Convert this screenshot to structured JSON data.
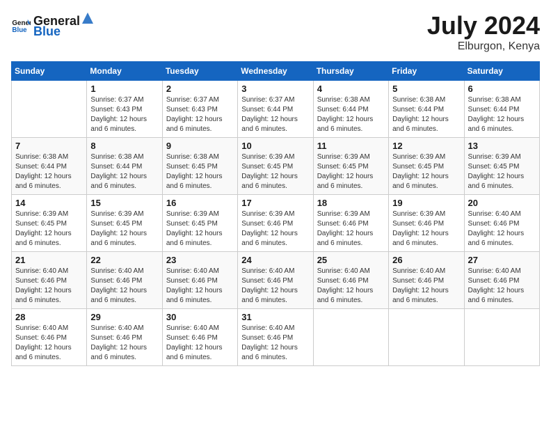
{
  "header": {
    "logo_general": "General",
    "logo_blue": "Blue",
    "month": "July 2024",
    "location": "Elburgon, Kenya"
  },
  "weekdays": [
    "Sunday",
    "Monday",
    "Tuesday",
    "Wednesday",
    "Thursday",
    "Friday",
    "Saturday"
  ],
  "weeks": [
    [
      {
        "day": "",
        "sunrise": "",
        "sunset": "",
        "daylight": ""
      },
      {
        "day": "1",
        "sunrise": "Sunrise: 6:37 AM",
        "sunset": "Sunset: 6:43 PM",
        "daylight": "Daylight: 12 hours and 6 minutes."
      },
      {
        "day": "2",
        "sunrise": "Sunrise: 6:37 AM",
        "sunset": "Sunset: 6:43 PM",
        "daylight": "Daylight: 12 hours and 6 minutes."
      },
      {
        "day": "3",
        "sunrise": "Sunrise: 6:37 AM",
        "sunset": "Sunset: 6:44 PM",
        "daylight": "Daylight: 12 hours and 6 minutes."
      },
      {
        "day": "4",
        "sunrise": "Sunrise: 6:38 AM",
        "sunset": "Sunset: 6:44 PM",
        "daylight": "Daylight: 12 hours and 6 minutes."
      },
      {
        "day": "5",
        "sunrise": "Sunrise: 6:38 AM",
        "sunset": "Sunset: 6:44 PM",
        "daylight": "Daylight: 12 hours and 6 minutes."
      },
      {
        "day": "6",
        "sunrise": "Sunrise: 6:38 AM",
        "sunset": "Sunset: 6:44 PM",
        "daylight": "Daylight: 12 hours and 6 minutes."
      }
    ],
    [
      {
        "day": "7",
        "sunrise": "Sunrise: 6:38 AM",
        "sunset": "Sunset: 6:44 PM",
        "daylight": "Daylight: 12 hours and 6 minutes."
      },
      {
        "day": "8",
        "sunrise": "Sunrise: 6:38 AM",
        "sunset": "Sunset: 6:44 PM",
        "daylight": "Daylight: 12 hours and 6 minutes."
      },
      {
        "day": "9",
        "sunrise": "Sunrise: 6:38 AM",
        "sunset": "Sunset: 6:45 PM",
        "daylight": "Daylight: 12 hours and 6 minutes."
      },
      {
        "day": "10",
        "sunrise": "Sunrise: 6:39 AM",
        "sunset": "Sunset: 6:45 PM",
        "daylight": "Daylight: 12 hours and 6 minutes."
      },
      {
        "day": "11",
        "sunrise": "Sunrise: 6:39 AM",
        "sunset": "Sunset: 6:45 PM",
        "daylight": "Daylight: 12 hours and 6 minutes."
      },
      {
        "day": "12",
        "sunrise": "Sunrise: 6:39 AM",
        "sunset": "Sunset: 6:45 PM",
        "daylight": "Daylight: 12 hours and 6 minutes."
      },
      {
        "day": "13",
        "sunrise": "Sunrise: 6:39 AM",
        "sunset": "Sunset: 6:45 PM",
        "daylight": "Daylight: 12 hours and 6 minutes."
      }
    ],
    [
      {
        "day": "14",
        "sunrise": "Sunrise: 6:39 AM",
        "sunset": "Sunset: 6:45 PM",
        "daylight": "Daylight: 12 hours and 6 minutes."
      },
      {
        "day": "15",
        "sunrise": "Sunrise: 6:39 AM",
        "sunset": "Sunset: 6:45 PM",
        "daylight": "Daylight: 12 hours and 6 minutes."
      },
      {
        "day": "16",
        "sunrise": "Sunrise: 6:39 AM",
        "sunset": "Sunset: 6:45 PM",
        "daylight": "Daylight: 12 hours and 6 minutes."
      },
      {
        "day": "17",
        "sunrise": "Sunrise: 6:39 AM",
        "sunset": "Sunset: 6:46 PM",
        "daylight": "Daylight: 12 hours and 6 minutes."
      },
      {
        "day": "18",
        "sunrise": "Sunrise: 6:39 AM",
        "sunset": "Sunset: 6:46 PM",
        "daylight": "Daylight: 12 hours and 6 minutes."
      },
      {
        "day": "19",
        "sunrise": "Sunrise: 6:39 AM",
        "sunset": "Sunset: 6:46 PM",
        "daylight": "Daylight: 12 hours and 6 minutes."
      },
      {
        "day": "20",
        "sunrise": "Sunrise: 6:40 AM",
        "sunset": "Sunset: 6:46 PM",
        "daylight": "Daylight: 12 hours and 6 minutes."
      }
    ],
    [
      {
        "day": "21",
        "sunrise": "Sunrise: 6:40 AM",
        "sunset": "Sunset: 6:46 PM",
        "daylight": "Daylight: 12 hours and 6 minutes."
      },
      {
        "day": "22",
        "sunrise": "Sunrise: 6:40 AM",
        "sunset": "Sunset: 6:46 PM",
        "daylight": "Daylight: 12 hours and 6 minutes."
      },
      {
        "day": "23",
        "sunrise": "Sunrise: 6:40 AM",
        "sunset": "Sunset: 6:46 PM",
        "daylight": "Daylight: 12 hours and 6 minutes."
      },
      {
        "day": "24",
        "sunrise": "Sunrise: 6:40 AM",
        "sunset": "Sunset: 6:46 PM",
        "daylight": "Daylight: 12 hours and 6 minutes."
      },
      {
        "day": "25",
        "sunrise": "Sunrise: 6:40 AM",
        "sunset": "Sunset: 6:46 PM",
        "daylight": "Daylight: 12 hours and 6 minutes."
      },
      {
        "day": "26",
        "sunrise": "Sunrise: 6:40 AM",
        "sunset": "Sunset: 6:46 PM",
        "daylight": "Daylight: 12 hours and 6 minutes."
      },
      {
        "day": "27",
        "sunrise": "Sunrise: 6:40 AM",
        "sunset": "Sunset: 6:46 PM",
        "daylight": "Daylight: 12 hours and 6 minutes."
      }
    ],
    [
      {
        "day": "28",
        "sunrise": "Sunrise: 6:40 AM",
        "sunset": "Sunset: 6:46 PM",
        "daylight": "Daylight: 12 hours and 6 minutes."
      },
      {
        "day": "29",
        "sunrise": "Sunrise: 6:40 AM",
        "sunset": "Sunset: 6:46 PM",
        "daylight": "Daylight: 12 hours and 6 minutes."
      },
      {
        "day": "30",
        "sunrise": "Sunrise: 6:40 AM",
        "sunset": "Sunset: 6:46 PM",
        "daylight": "Daylight: 12 hours and 6 minutes."
      },
      {
        "day": "31",
        "sunrise": "Sunrise: 6:40 AM",
        "sunset": "Sunset: 6:46 PM",
        "daylight": "Daylight: 12 hours and 6 minutes."
      },
      {
        "day": "",
        "sunrise": "",
        "sunset": "",
        "daylight": ""
      },
      {
        "day": "",
        "sunrise": "",
        "sunset": "",
        "daylight": ""
      },
      {
        "day": "",
        "sunrise": "",
        "sunset": "",
        "daylight": ""
      }
    ]
  ]
}
